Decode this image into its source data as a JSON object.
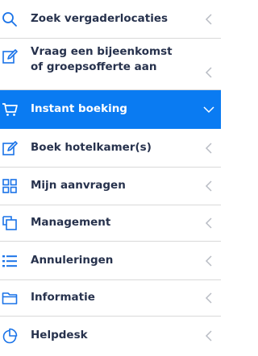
{
  "menu": {
    "items": [
      {
        "label": "Zoek vergaderlocaties",
        "icon": "search-icon"
      },
      {
        "label": "Vraag een bijeenkomst of groepsofferte aan",
        "icon": "edit-icon"
      },
      {
        "label": "Instant boeking",
        "icon": "cart-icon",
        "state": "expanded"
      },
      {
        "label": "Boek hotelkamer(s)",
        "icon": "edit-icon"
      },
      {
        "label": "Mijn aanvragen",
        "icon": "grid-icon"
      },
      {
        "label": "Management",
        "icon": "copy-icon"
      },
      {
        "label": "Annuleringen",
        "icon": "list-icon"
      },
      {
        "label": "Informatie",
        "icon": "folder-icon"
      },
      {
        "label": "Helpdesk",
        "icon": "pie-chart-icon"
      }
    ]
  },
  "colors": {
    "accent": "#0a7bf2",
    "text": "#27324d",
    "icon": "#1a73e8",
    "chevron": "#b8bcc4",
    "divider": "#d9d9d9"
  }
}
